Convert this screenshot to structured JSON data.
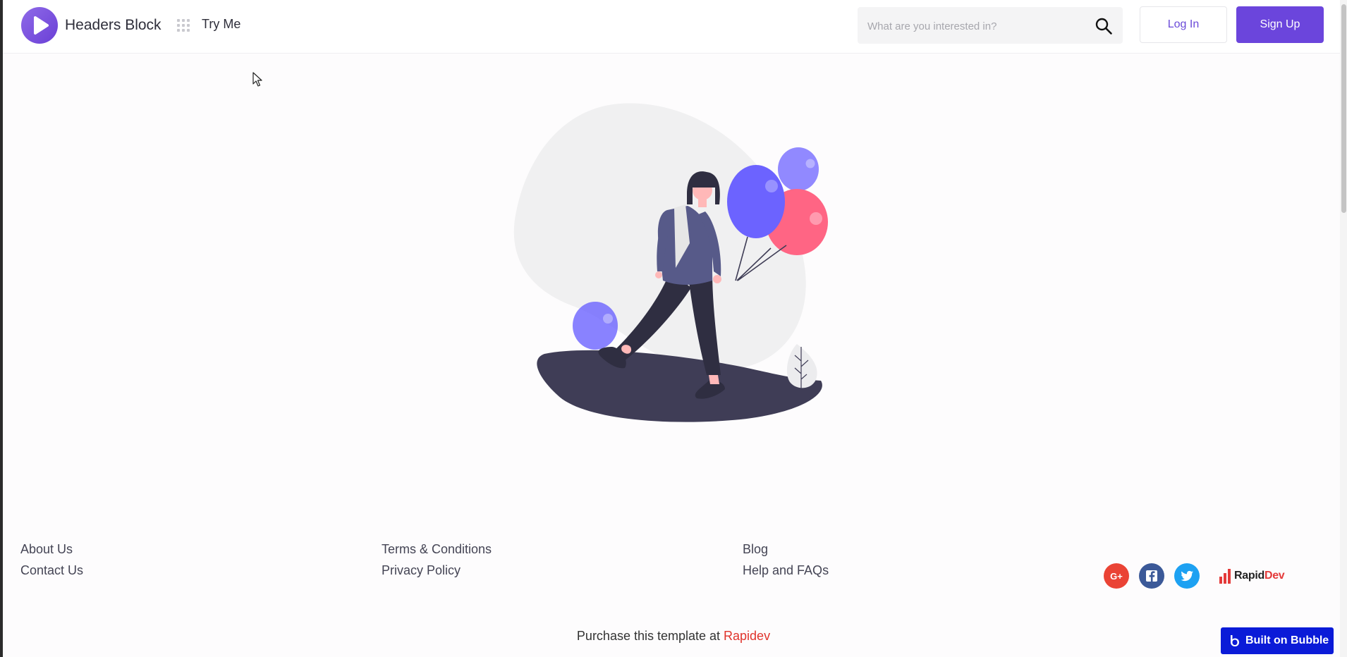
{
  "header": {
    "brand": "Headers Block",
    "nav_item": "Try Me",
    "search_placeholder": "What are you interested in?",
    "search_value": "",
    "login_label": "Log In",
    "signup_label": "Sign Up"
  },
  "footer": {
    "col1": [
      "About Us",
      "Contact Us"
    ],
    "col2": [
      "Terms & Conditions",
      "Privacy Policy"
    ],
    "col3": [
      "Blog",
      "Help and FAQs"
    ],
    "social": [
      "google-plus-icon",
      "facebook-icon",
      "twitter-icon"
    ],
    "rapid_logo": {
      "part1": "Rapid",
      "part2": "Dev"
    },
    "purchase_text": "Purchase this template at ",
    "purchase_link": "Rapidev"
  },
  "badge": {
    "label": "Built on Bubble"
  },
  "colors": {
    "accent": "#6b45dc",
    "link_red": "#e0332b",
    "bubble_blue": "#0b1bd8",
    "google": "#ea4335",
    "facebook": "#3b5998",
    "twitter": "#1da1f2"
  }
}
